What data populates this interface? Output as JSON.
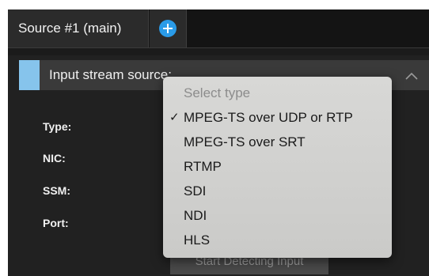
{
  "tabs": {
    "main_label": "Source #1 (main)"
  },
  "section": {
    "title": "Input stream source:"
  },
  "fields": {
    "type_label": "Type:",
    "nic_label": "NIC:",
    "ssm_label": "SSM:",
    "port_label": "Port:"
  },
  "start_button_label": "Start Detecting Input",
  "dropdown": {
    "placeholder": "Select type",
    "checkmark": "✓",
    "options": [
      "MPEG-TS over UDP or RTP",
      "MPEG-TS over SRT",
      "RTMP",
      "SDI",
      "NDI",
      "HLS"
    ],
    "selected_index": 0
  },
  "colors": {
    "accent": "#86c4ec",
    "add_button": "#2a9be8"
  }
}
